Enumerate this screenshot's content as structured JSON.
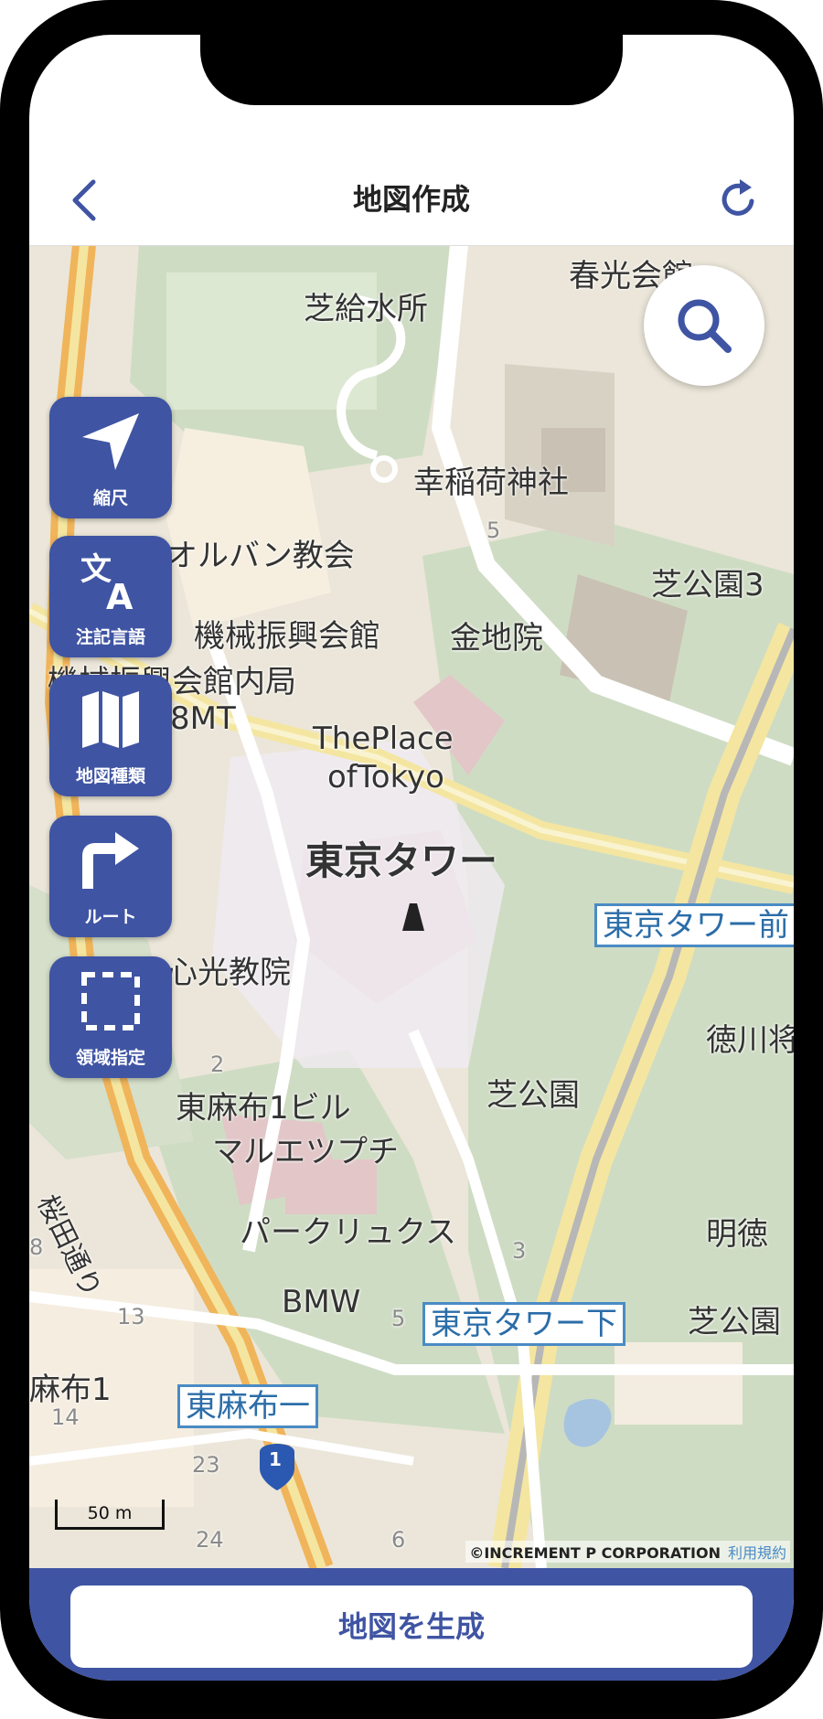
{
  "header": {
    "title": "地図作成"
  },
  "map": {
    "labels": {
      "l1": "芝給水所",
      "l2": "春光会館",
      "l3": "幸稲荷神社",
      "l4": "オルバン教会",
      "l5": "芝公園3",
      "l6": "機械振興会館",
      "l7": "金地院",
      "l8": "機械振興会館内局",
      "l9": "8MT",
      "l10": "ThePlace",
      "l11": "ofTokyo",
      "l12": "東京タワー",
      "l13": "心光教院",
      "l14": "徳川将",
      "l15": "芝公園",
      "l16": "東麻布1ビル",
      "l17": "マルエツプチ",
      "l18": "明徳",
      "l19": "パークリュクス",
      "l20": "BMW",
      "l21": "芝公園",
      "l22": "麻布1",
      "l23": "桜田通り"
    },
    "numbers": {
      "n1": "5",
      "n2": "2",
      "n3": "3",
      "n4": "5",
      "n5": "13",
      "n6": "14",
      "n7": "23",
      "n8": "24",
      "n9": "6",
      "n10": "8"
    },
    "stations": {
      "s1": "東京タワー前",
      "s2": "東京タワー下",
      "s3": "東麻布一"
    },
    "route_shield": "1",
    "scale_label": "50 m",
    "copyright": "©INCREMENT P CORPORATION",
    "terms_link": "利用規約"
  },
  "tools": [
    {
      "label": "縮尺",
      "icon": "navigation-arrow-icon"
    },
    {
      "label": "注記言語",
      "icon": "translate-icon"
    },
    {
      "label": "地図種類",
      "icon": "map-icon"
    },
    {
      "label": "ルート",
      "icon": "turn-right-arrow-icon"
    },
    {
      "label": "領域指定",
      "icon": "dashed-square-icon"
    }
  ],
  "footer": {
    "generate_label": "地図を生成"
  },
  "colors": {
    "primary": "#3f54a3",
    "park": "#cfdcc4",
    "road": "#f4e6a0"
  }
}
